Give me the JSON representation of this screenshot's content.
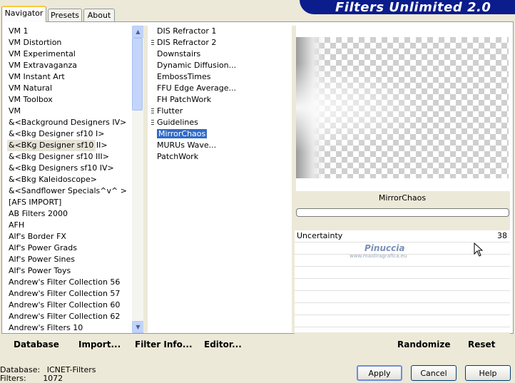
{
  "tabs": [
    "Navigator",
    "Presets",
    "About"
  ],
  "banner_title": "Filters Unlimited 2.0",
  "categories": [
    "VM 1",
    "VM Distortion",
    "VM Experimental",
    "VM Extravaganza",
    "VM Instant Art",
    "VM Natural",
    "VM Toolbox",
    "VM",
    "&<Background Designers IV>",
    "&<Bkg Designer sf10 I>",
    "&<BKg Designer sf10 II>",
    "&<Bkg Designer sf10 III>",
    "&<Bkg Designers sf10 IV>",
    "&<Bkg Kaleidoscope>",
    "&<Sandflower Specials^v^ >",
    "[AFS IMPORT]",
    "AB Filters 2000",
    "AFH",
    "Alf's Border FX",
    "Alf's Power Grads",
    "Alf's Power Sines",
    "Alf's Power Toys",
    "Andrew's Filter Collection 56",
    "Andrew's Filter Collection 57",
    "Andrew's Filter Collection 60",
    "Andrew's Filter Collection 62",
    "Andrew's Filters 10"
  ],
  "selected_category_index": 10,
  "filters": [
    {
      "label": "DIS Refractor 1",
      "fav": false
    },
    {
      "label": "DIS Refractor 2",
      "fav": true
    },
    {
      "label": "Downstairs",
      "fav": false
    },
    {
      "label": "Dynamic Diffusion...",
      "fav": false
    },
    {
      "label": "EmbossTimes",
      "fav": false
    },
    {
      "label": "FFU Edge Average...",
      "fav": false
    },
    {
      "label": "FH PatchWork",
      "fav": false
    },
    {
      "label": "Flutter",
      "fav": true
    },
    {
      "label": "Guidelines",
      "fav": true
    },
    {
      "label": "MirrorChaos",
      "fav": false
    },
    {
      "label": "MURUs Wave...",
      "fav": false
    },
    {
      "label": "PatchWork",
      "fav": false
    }
  ],
  "selected_filter_index": 9,
  "filter_name": "MirrorChaos",
  "parameter": {
    "name": "Uncertainty",
    "value": "38"
  },
  "watermark": "Pinuccia",
  "watermark_url": "www.maidiragrafica.eu",
  "toolbar": {
    "database": "Database",
    "import": "Import...",
    "filter_info": "Filter Info...",
    "editor": "Editor...",
    "randomize": "Randomize",
    "reset": "Reset"
  },
  "status": {
    "database_label": "Database:",
    "database_value": "ICNET-Filters",
    "filters_label": "Filters:",
    "filters_value": "1072"
  },
  "buttons": {
    "apply": "Apply",
    "cancel": "Cancel",
    "help": "Help"
  }
}
